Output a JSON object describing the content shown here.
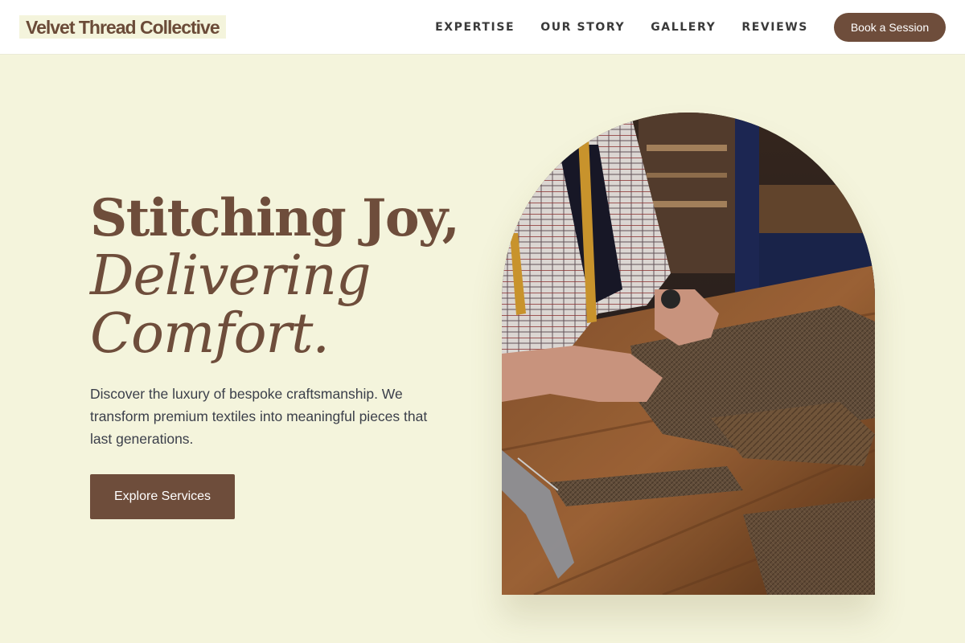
{
  "header": {
    "logo": "Velvet Thread Collective",
    "nav": [
      "EXPERTISE",
      "OUR STORY",
      "GALLERY",
      "REVIEWS"
    ],
    "cta_label": "Book a Session"
  },
  "hero": {
    "title_line1": "Stitching Joy,",
    "title_line2": "Delivering",
    "title_line3": "Comfort.",
    "description": "Discover the luxury of bespoke craftsmanship. We transform premium textiles into meaningful pieces that last generations.",
    "button_label": "Explore Services"
  },
  "colors": {
    "accent": "#6e4d3b",
    "background": "#f4f4dc",
    "header_bg": "#ffffff",
    "body_text": "#3b3f4a"
  }
}
